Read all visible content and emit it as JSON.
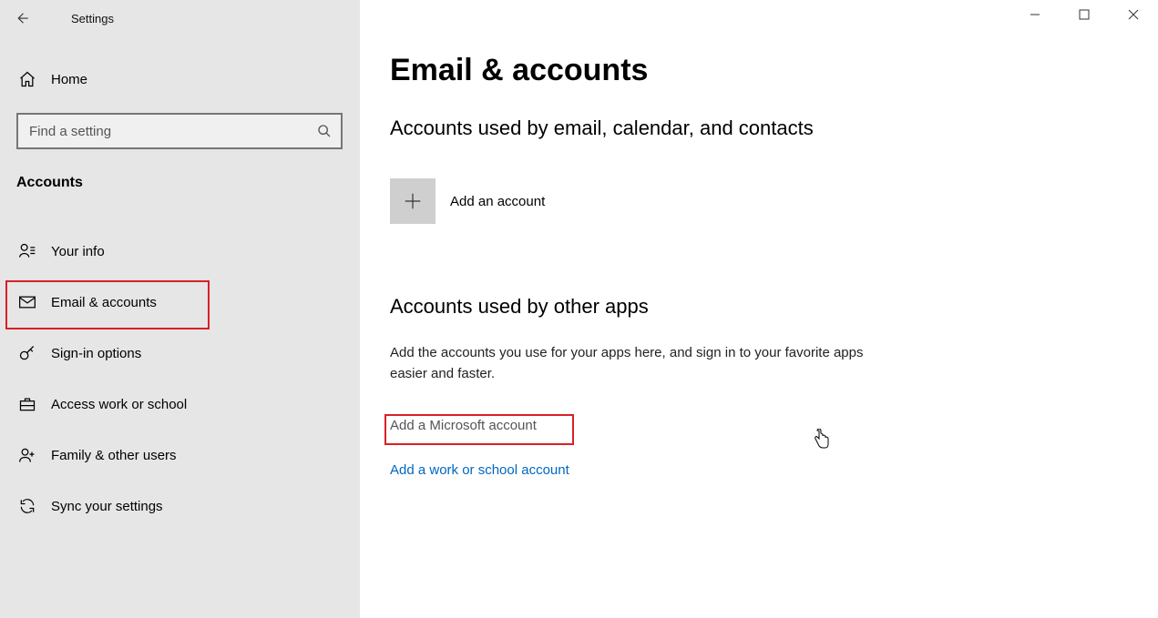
{
  "app": {
    "title": "Settings"
  },
  "sidebar": {
    "home": "Home",
    "search_placeholder": "Find a setting",
    "category": "Accounts",
    "items": [
      {
        "label": "Your info",
        "icon": "person-icon"
      },
      {
        "label": "Email & accounts",
        "icon": "mail-icon"
      },
      {
        "label": "Sign-in options",
        "icon": "key-icon"
      },
      {
        "label": "Access work or school",
        "icon": "briefcase-icon"
      },
      {
        "label": "Family & other users",
        "icon": "people-plus-icon"
      },
      {
        "label": "Sync your settings",
        "icon": "sync-icon"
      }
    ]
  },
  "main": {
    "title": "Email & accounts",
    "section1": {
      "header": "Accounts used by email, calendar, and contacts",
      "add_label": "Add an account"
    },
    "section2": {
      "header": "Accounts used by other apps",
      "desc": "Add the accounts you use for your apps here, and sign in to your favorite apps easier and faster.",
      "link_ms": "Add a Microsoft account",
      "link_ws": "Add a work or school account"
    }
  }
}
